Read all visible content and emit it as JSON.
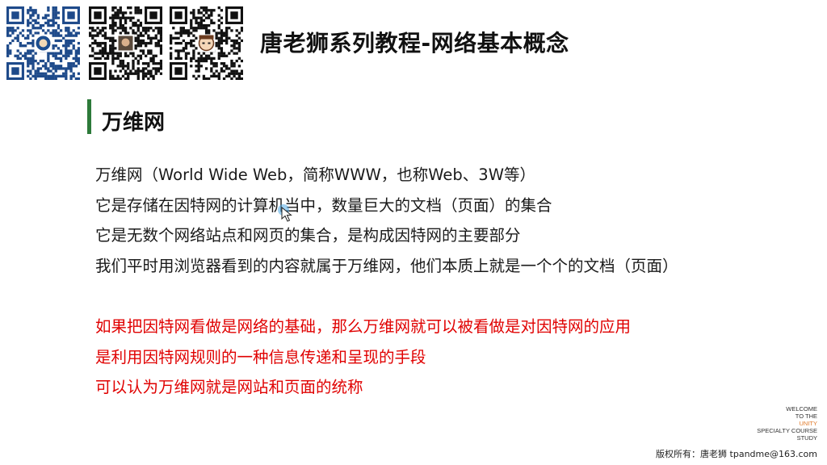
{
  "header": {
    "title": "唐老狮系列教程-网络基本概念",
    "qr_codes": [
      {
        "icon": "qr-code-icon",
        "center": "avatar"
      },
      {
        "icon": "qr-code-icon",
        "center": "photo"
      },
      {
        "icon": "qr-code-icon",
        "center": "cartoon-face"
      }
    ]
  },
  "section": {
    "title": "万维网",
    "accent_color": "#2d7a3a"
  },
  "body": {
    "lines": [
      "万维网（World Wide Web，简称WWW，也称Web、3W等）",
      "它是存储在因特网的计算机当中，数量巨大的文档（页面）的集合",
      "它是无数个网络站点和网页的集合，是构成因特网的主要部分",
      "我们平时用浏览器看到的内容就属于万维网，他们本质上就是一个个的文档（页面）"
    ],
    "highlight_lines": [
      "如果把因特网看做是网络的基础，那么万维网就可以被看做是对因特网的应用",
      "是利用因特网规则的一种信息传递和呈现的手段",
      "可以认为万维网就是网站和页面的统称"
    ],
    "highlight_color": "#e00000"
  },
  "branding": {
    "welcome_lines": [
      "WELCOME",
      "TO THE",
      "UNITY",
      "SPECIALTY COURSE",
      "STUDY"
    ],
    "copyright": "版权所有：唐老狮 tpandme@163.com"
  }
}
